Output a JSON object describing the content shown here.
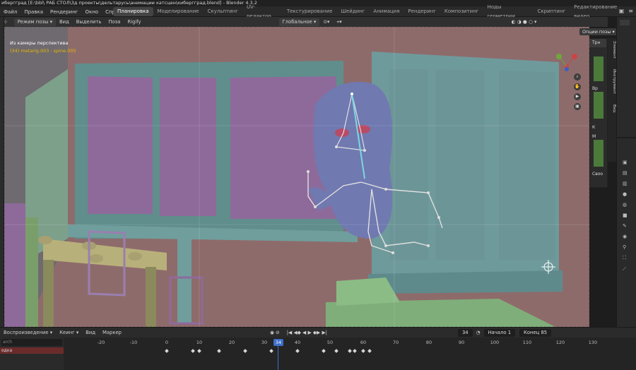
{
  "titlebar": {
    "text": "ибергград [E:\\bbl\\ РАБ СТОЛ\\3д проекты\\дельтарусь\\анимации катсцен\\кибергград.blend] - Blender 4.3.2"
  },
  "menu": [
    "Файл",
    "Правка",
    "Рендеринг",
    "Окно",
    "Справка"
  ],
  "workspace_tabs": [
    {
      "label": "Планировка",
      "active": true
    },
    {
      "label": "Моделирование",
      "active": false
    },
    {
      "label": "Скульптинг",
      "active": false
    },
    {
      "label": "UV-редактор",
      "active": false
    },
    {
      "label": "Текстурирование",
      "active": false
    },
    {
      "label": "Шейдинг",
      "active": false
    },
    {
      "label": "Анимация",
      "active": false
    },
    {
      "label": "Рендеринг",
      "active": false
    },
    {
      "label": "Композитинг",
      "active": false
    },
    {
      "label": "Ноды геометрии",
      "active": false
    },
    {
      "label": "Скриптинг",
      "active": false
    },
    {
      "label": "Редактирование видео",
      "active": false
    }
  ],
  "viewport_header": {
    "mode": "Режим позы",
    "items": [
      "Вид",
      "Выделить",
      "Поза",
      "Rigify"
    ],
    "orientation": "Глобальное",
    "options": "Опции позы"
  },
  "viewport": {
    "title": "Из камеры перспектива",
    "subtitle": "(34) metarig.003 : spine.005"
  },
  "npanel": {
    "tab": "Трн",
    "labels": [
      "Вр",
      "К",
      "М",
      "Своо"
    ]
  },
  "sidebar_tabs": [
    "Элемент",
    "Инструмент",
    "Вид"
  ],
  "timeline_header": {
    "playback": "Воспроизведение",
    "keying": "Кеинг",
    "view": "Вид",
    "marker": "Маркер",
    "current_frame": "34",
    "start_label": "Начало",
    "start_value": "1",
    "end_label": "Конец",
    "end_value": "85"
  },
  "timeline": {
    "search_placeholder": "arch",
    "row_label": "одка",
    "ruler": [
      "-20",
      "-10",
      "0",
      "10",
      "20",
      "30",
      "34",
      "40",
      "50",
      "60",
      "70",
      "80",
      "90",
      "100",
      "110",
      "120",
      "130"
    ]
  },
  "colors": {
    "wall": "#8e6b6b",
    "teal": "#5f8e8c",
    "purple": "#8e6a9b",
    "green": "#7fae7a",
    "accent": "#3d6fc9"
  }
}
